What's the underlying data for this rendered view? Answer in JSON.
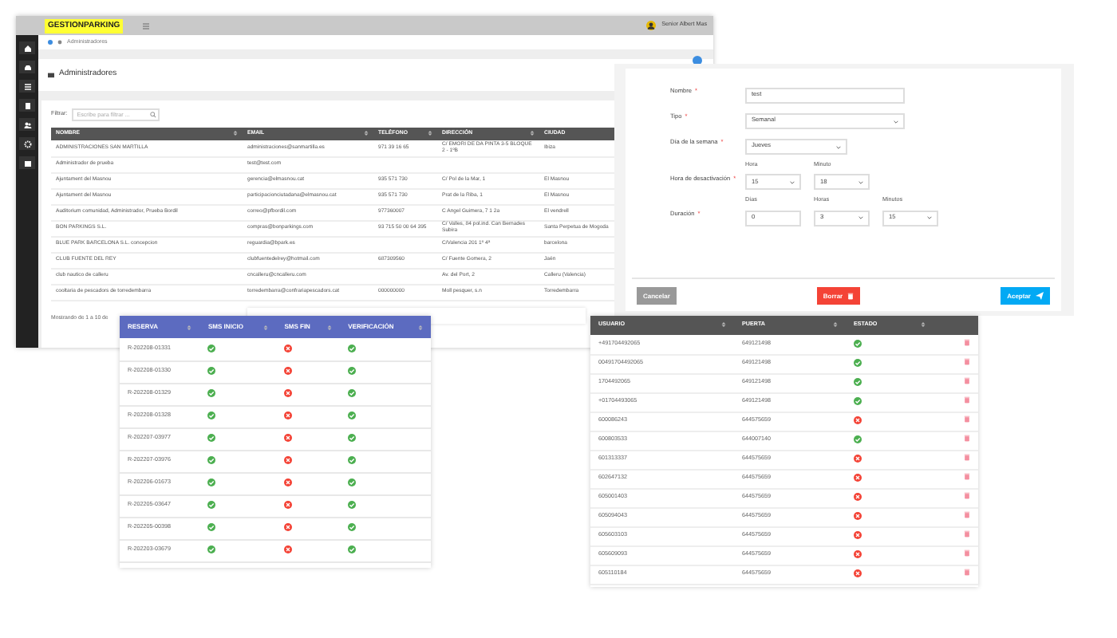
{
  "admin_app": {
    "logo": "GESTIONPARKING",
    "user_name": "Senior Albert Mas",
    "breadcrumb": "Administradores",
    "page_title": "Administradores",
    "filter": {
      "label": "Filtrar:",
      "placeholder": "Escribe para filtrar ..."
    },
    "table": {
      "columns": [
        "NOMBRE",
        "EMAIL",
        "TELÉFONO",
        "DIRECCIÓN",
        "CIUDAD"
      ],
      "rows": [
        [
          "ADMINISTRACIONES SAN MARTILLA",
          "administraciones@sanmartilla.es",
          "971 39 16 65",
          "C/ EMORI DE DA PINTA 3-5 BLOQUE 2 - 1ºB",
          "Ibiza"
        ],
        [
          "Administrador de prueba",
          "test@test.com",
          "",
          "",
          ""
        ],
        [
          "Ajuntament del Masnou",
          "gerencia@elmasnou.cat",
          "935 571 730",
          "C/ Pol de la Mar, 1",
          "El Masnou"
        ],
        [
          "Ajuntament del Masnou",
          "participacionciutadana@elmasnou.cat",
          "935 571 730",
          "Prat de la Riba, 1",
          "El Masnou"
        ],
        [
          "Auditorium comunidad, Administrador, Prueba Bordil",
          "correo@pfbordil.com",
          "977360007",
          "C Angel Guimera, 7 1 2a",
          "El vendrell"
        ],
        [
          "BON PARKINGS S.L.",
          "compras@bonparkings.com",
          "93 715 50 00 64 395",
          "C/ Valles, 84 pol.ind. Can Bernades Subira",
          "Santa Perpetua de Mogoda"
        ],
        [
          "BLUE PARK BARCELONA S.L. concepcion",
          "reguardia@bpark.es",
          "",
          "C/Valencia 201 1º 4ª",
          "barcelona"
        ],
        [
          "CLUB FUENTE DEL REY",
          "clubfuentedelrey@hotmail.com",
          "687309560",
          "C/ Fuente Gomera, 2",
          "Jaén"
        ],
        [
          "club nautico de calleru",
          "cncalleru@cncalleru.com",
          "",
          "Av. del Port, 2",
          "Calleru (Valencia)"
        ],
        [
          "cooltaria de pescadors de torredembarra",
          "torredembarra@confrariapescadors.cat",
          "000000000",
          "Moll pesquer, s.n",
          "Torredembarra"
        ]
      ],
      "footer": "Mostrando de 1 a 10 de"
    }
  },
  "schedule_form": {
    "fields": [
      {
        "label": "Nombre",
        "required_mark": "*",
        "kind": "input",
        "value": "test"
      },
      {
        "label": "Tipo",
        "required_mark": "*",
        "kind": "select",
        "value": "Semanal"
      },
      {
        "label": "Día de la semana",
        "required_mark": "*",
        "kind": "short-select",
        "value": "Jueves"
      },
      {
        "label": "Hora de desactivación",
        "required_mark": "*",
        "kind": "group",
        "parts": [
          {
            "caption": "Hora",
            "kind": "select",
            "value": "15"
          },
          {
            "caption": "Minuto",
            "kind": "select",
            "value": "18"
          }
        ]
      },
      {
        "label": "Duración",
        "required_mark": "*",
        "kind": "group",
        "parts": [
          {
            "caption": "Días",
            "kind": "input",
            "value": "0"
          },
          {
            "caption": "Horas",
            "kind": "select",
            "value": "3"
          },
          {
            "caption": "Minutos",
            "kind": "select",
            "value": "15"
          }
        ]
      }
    ],
    "buttons": [
      {
        "label": "Cancelar",
        "kind": "cancel"
      },
      {
        "label": "Borrar",
        "kind": "delete"
      },
      {
        "label": "Aceptar",
        "kind": "accept"
      }
    ]
  },
  "sms_table": {
    "columns": [
      "RESERVA",
      "SMS INICIO",
      "SMS FIN",
      "VERIFICACIÓN"
    ],
    "rows": [
      {
        "reserva": "R-202208-01331",
        "sms_start_ok": true,
        "sms_end_ok": false,
        "verified": true
      },
      {
        "reserva": "R-202208-01330",
        "sms_start_ok": true,
        "sms_end_ok": false,
        "verified": true
      },
      {
        "reserva": "R-202208-01329",
        "sms_start_ok": true,
        "sms_end_ok": false,
        "verified": true
      },
      {
        "reserva": "R-202208-01328",
        "sms_start_ok": true,
        "sms_end_ok": false,
        "verified": true
      },
      {
        "reserva": "R-202207-03977",
        "sms_start_ok": true,
        "sms_end_ok": false,
        "verified": true
      },
      {
        "reserva": "R-202207-03976",
        "sms_start_ok": true,
        "sms_end_ok": false,
        "verified": true
      },
      {
        "reserva": "R-202206-01673",
        "sms_start_ok": true,
        "sms_end_ok": false,
        "verified": true
      },
      {
        "reserva": "R-202205-03647",
        "sms_start_ok": true,
        "sms_end_ok": false,
        "verified": true
      },
      {
        "reserva": "R-202205-00398",
        "sms_start_ok": true,
        "sms_end_ok": false,
        "verified": true
      },
      {
        "reserva": "R-202203-03679",
        "sms_start_ok": true,
        "sms_end_ok": false,
        "verified": true
      }
    ]
  },
  "doors_table": {
    "columns": [
      "USUARIO",
      "PUERTA",
      "ESTADO"
    ],
    "rows": [
      {
        "usuario": "+491704492065",
        "puerta": "649121498",
        "ok": true
      },
      {
        "usuario": "00491704492065",
        "puerta": "649121498",
        "ok": true
      },
      {
        "usuario": "1704492065",
        "puerta": "649121498",
        "ok": true
      },
      {
        "usuario": "+01704493065",
        "puerta": "649121498",
        "ok": true
      },
      {
        "usuario": "600086243",
        "puerta": "644575659",
        "ok": false
      },
      {
        "usuario": "600803533",
        "puerta": "644007140",
        "ok": true
      },
      {
        "usuario": "601313337",
        "puerta": "644575659",
        "ok": false
      },
      {
        "usuario": "602647132",
        "puerta": "644575659",
        "ok": false
      },
      {
        "usuario": "605001403",
        "puerta": "644575659",
        "ok": false
      },
      {
        "usuario": "605094043",
        "puerta": "644575659",
        "ok": false
      },
      {
        "usuario": "605603103",
        "puerta": "644575659",
        "ok": false
      },
      {
        "usuario": "605609093",
        "puerta": "644575659",
        "ok": false
      },
      {
        "usuario": "605110184",
        "puerta": "644575659",
        "ok": false
      }
    ]
  }
}
